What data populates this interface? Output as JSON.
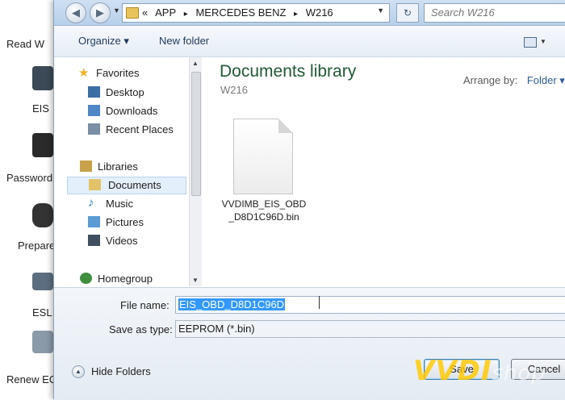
{
  "background_app": {
    "buttons": [
      {
        "label": "Read W",
        "icon": "chip-icon",
        "color": "#6b7c8c"
      },
      {
        "label": "EIS",
        "icon": "ignition-icon",
        "color": "#3c4a58"
      },
      {
        "label": "Password",
        "icon": "key-icon",
        "color": "#2a2a2a"
      },
      {
        "label": "Prepare",
        "icon": "remote-key-icon",
        "color": "#333333"
      },
      {
        "label": "ESL",
        "icon": "lock-module-icon",
        "color": "#5c6e80"
      },
      {
        "label": "Renew EC",
        "icon": "ecu-icon",
        "color": "#8a9aa8"
      }
    ]
  },
  "dialog": {
    "nav": {
      "back_icon": "back-arrow-icon",
      "forward_icon": "forward-arrow-icon"
    },
    "address": {
      "prefix": "«",
      "crumbs": [
        "APP",
        "▸",
        "MERCEDES BENZ",
        "▸",
        "W216"
      ],
      "dropdown": "▼"
    },
    "refresh_glyph": "↻",
    "search": {
      "placeholder": "Search W216"
    },
    "toolbar": {
      "organize": "Organize ▾",
      "new_folder": "New folder"
    },
    "navigation": {
      "items": [
        {
          "label": "Favorites",
          "icon": "star-icon",
          "color": "#f0b429",
          "kind": "group"
        },
        {
          "label": "Desktop",
          "icon": "desktop-icon",
          "color": "#3b6ea5",
          "kind": "item"
        },
        {
          "label": "Downloads",
          "icon": "downloads-icon",
          "color": "#4f86c6",
          "kind": "item"
        },
        {
          "label": "Recent Places",
          "icon": "recent-places-icon",
          "color": "#7a8fa6",
          "kind": "item"
        },
        {
          "label": "Libraries",
          "icon": "library-icon",
          "color": "#c9a14a",
          "kind": "group"
        },
        {
          "label": "Documents",
          "icon": "documents-icon",
          "color": "#e2c26a",
          "kind": "item",
          "selected": true
        },
        {
          "label": "Music",
          "icon": "music-icon",
          "color": "#2f79c4",
          "kind": "item"
        },
        {
          "label": "Pictures",
          "icon": "pictures-icon",
          "color": "#5a9bd6",
          "kind": "item"
        },
        {
          "label": "Videos",
          "icon": "videos-icon",
          "color": "#3f4f60",
          "kind": "item"
        },
        {
          "label": "Homegroup",
          "icon": "homegroup-icon",
          "color": "#3f8f3f",
          "kind": "group"
        }
      ]
    },
    "content": {
      "title": "Documents library",
      "subtitle": "W216",
      "arrange_by_label": "Arrange by:",
      "arrange_by_value": "Folder ▾",
      "files": [
        {
          "name_line1": "VVDIMB_EIS_OBD",
          "name_line2": "_D8D1C96D.bin",
          "icon": "file-icon"
        }
      ]
    },
    "bottom": {
      "file_name_label": "File name:",
      "file_name_value": "EIS_OBD_D8D1C96D",
      "save_type_label": "Save as type:",
      "save_type_value": "EEPROM (*.bin)",
      "hide_folders": "Hide Folders",
      "save_button": "Save",
      "cancel_button": "Cancel"
    }
  },
  "watermark": {
    "brand": "VVDI",
    "suffix": "shop"
  }
}
